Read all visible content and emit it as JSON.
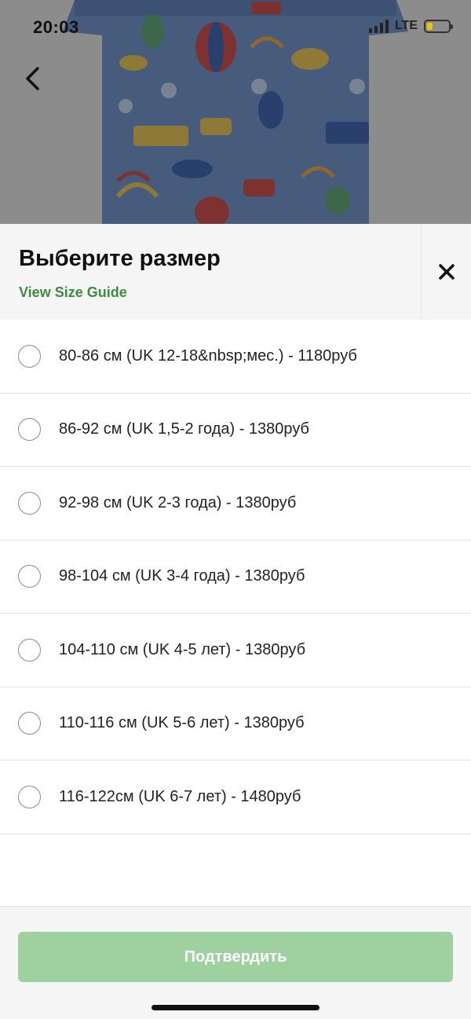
{
  "status_bar": {
    "time": "20:03",
    "network": "LTE"
  },
  "product_image": {
    "description_icon": "dinosaur-print-tshirt-image"
  },
  "navigation": {
    "back_icon": "chevron-left-icon"
  },
  "sheet": {
    "title": "Выберите размер",
    "size_guide_link": "View Size Guide",
    "close_icon": "close-icon",
    "sizes": [
      {
        "label": "80-86 см (UK 12-18&nbsp;мес.) - 1180руб",
        "selected": false
      },
      {
        "label": "86-92 см (UK 1,5-2 года) - 1380руб",
        "selected": false
      },
      {
        "label": "92-98 см (UK 2-3 года) - 1380руб",
        "selected": false
      },
      {
        "label": "98-104 см (UK 3-4 года) - 1380руб",
        "selected": false
      },
      {
        "label": "104-110 см (UK 4-5 лет) - 1380руб",
        "selected": false
      },
      {
        "label": "110-116 см (UK 5-6 лет) - 1380руб",
        "selected": false
      },
      {
        "label": "116-122см (UK 6-7 лет) - 1480руб",
        "selected": false
      }
    ],
    "confirm_label": "Подтвердить"
  },
  "colors": {
    "accent_green": "#3e8a3e",
    "confirm_disabled": "#9fd09f",
    "header_bg": "#f5f5f5"
  }
}
